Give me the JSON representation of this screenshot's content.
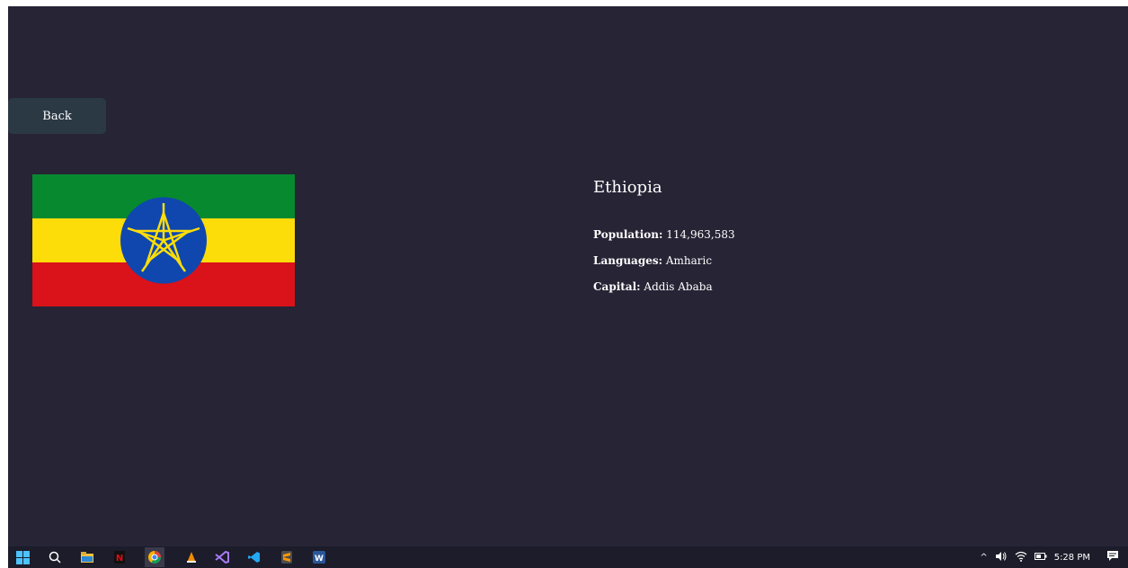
{
  "back_button": {
    "label": "Back"
  },
  "country": {
    "name": "Ethiopia",
    "details": [
      {
        "label": "Population:",
        "value": "114,963,583"
      },
      {
        "label": "Languages:",
        "value": "Amharic"
      },
      {
        "label": "Capital:",
        "value": "Addis Ababa"
      }
    ],
    "flag": {
      "stripes": [
        "#078930",
        "#FCDD09",
        "#DA121A"
      ],
      "emblem_circle": "#0F47AF",
      "emblem_star": "#FCDD09",
      "icon": "ethiopia-flag"
    }
  },
  "colors": {
    "background": "#262435",
    "button_bg": "#2b3945",
    "text": "#ffffff"
  },
  "taskbar": {
    "apps": [
      "windows-start-icon",
      "search-icon",
      "file-explorer-icon",
      "netflix-icon",
      "chrome-icon",
      "vlc-icon",
      "visual-studio-icon",
      "vscode-icon",
      "sublime-text-icon",
      "word-icon"
    ],
    "tray": {
      "chevron": "^",
      "time": "5:28 PM"
    }
  }
}
